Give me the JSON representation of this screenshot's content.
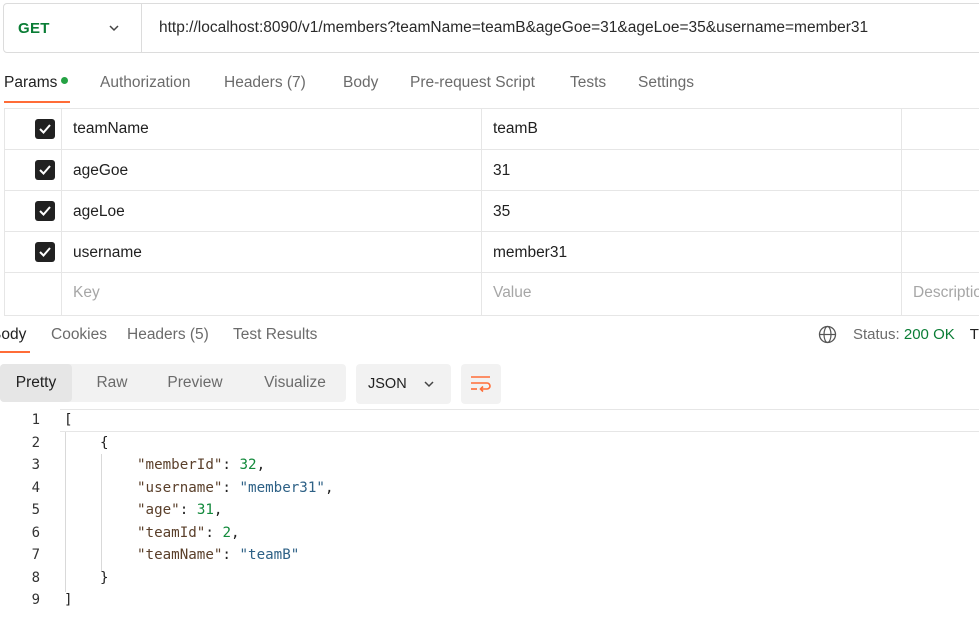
{
  "request": {
    "method": "GET",
    "url": "http://localhost:8090/v1/members?teamName=teamB&ageGoe=31&ageLoe=35&username=member31"
  },
  "request_tabs": {
    "params": "Params",
    "authorization": "Authorization",
    "headers": "Headers (7)",
    "body": "Body",
    "prerequest": "Pre-request Script",
    "tests": "Tests",
    "settings": "Settings"
  },
  "params": {
    "rows": [
      {
        "key": "teamName",
        "value": "teamB"
      },
      {
        "key": "ageGoe",
        "value": "31"
      },
      {
        "key": "ageLoe",
        "value": "35"
      },
      {
        "key": "username",
        "value": "member31"
      }
    ],
    "placeholder_key": "Key",
    "placeholder_value": "Value",
    "placeholder_description": "Description"
  },
  "response_tabs": {
    "body": "Body",
    "cookies": "Cookies",
    "headers": "Headers (5)",
    "test_results": "Test Results"
  },
  "status": {
    "label": "Status:",
    "value": "200 OK",
    "extra": "Ti"
  },
  "view": {
    "pretty": "Pretty",
    "raw": "Raw",
    "preview": "Preview",
    "visualize": "Visualize",
    "format": "JSON"
  },
  "code": {
    "line_numbers": [
      "1",
      "2",
      "3",
      "4",
      "5",
      "6",
      "7",
      "8",
      "9"
    ],
    "open_bracket": "[",
    "open_brace": "{",
    "fields": [
      {
        "key": "\"memberId\"",
        "value": "32",
        "type": "number"
      },
      {
        "key": "\"username\"",
        "value": "\"member31\"",
        "type": "string"
      },
      {
        "key": "\"age\"",
        "value": "31",
        "type": "number"
      },
      {
        "key": "\"teamId\"",
        "value": "2",
        "type": "number"
      },
      {
        "key": "\"teamName\"",
        "value": "\"teamB\"",
        "type": "string"
      }
    ],
    "close_brace": "}",
    "close_bracket": "]"
  },
  "colors": {
    "accent": "#ff6c37",
    "method_get": "#0a7d35",
    "status_ok": "#0a7d35"
  }
}
